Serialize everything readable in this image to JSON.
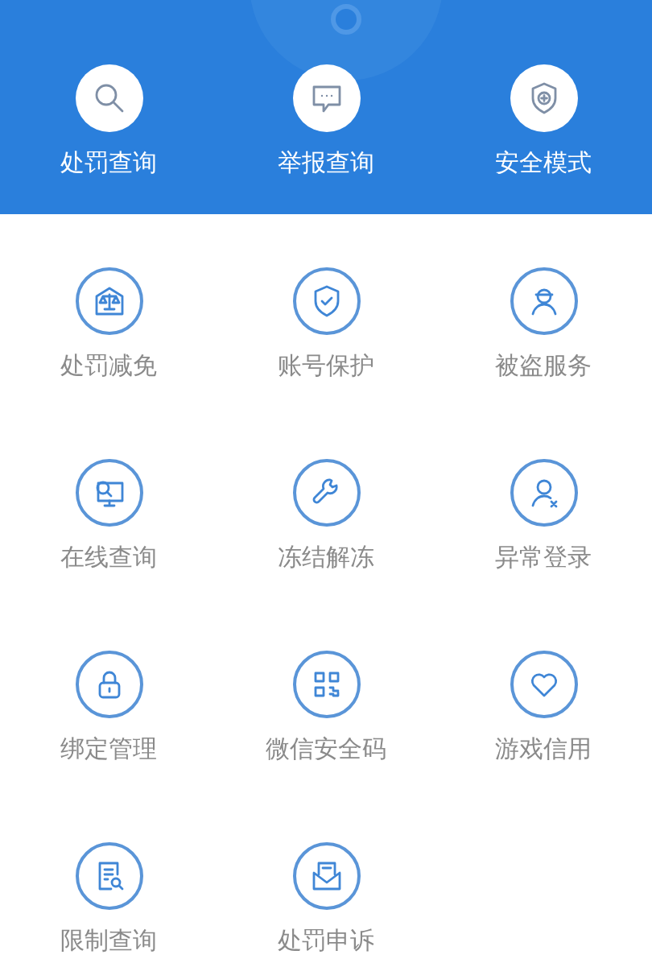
{
  "header": {
    "items": [
      {
        "label": "处罚查询"
      },
      {
        "label": "举报查询"
      },
      {
        "label": "安全模式"
      }
    ]
  },
  "services": [
    {
      "label": "处罚减免"
    },
    {
      "label": "账号保护"
    },
    {
      "label": "被盗服务"
    },
    {
      "label": "在线查询"
    },
    {
      "label": "冻结解冻"
    },
    {
      "label": "异常登录"
    },
    {
      "label": "绑定管理"
    },
    {
      "label": "微信安全码"
    },
    {
      "label": "游戏信用"
    },
    {
      "label": "限制查询"
    },
    {
      "label": "处罚申诉"
    }
  ]
}
